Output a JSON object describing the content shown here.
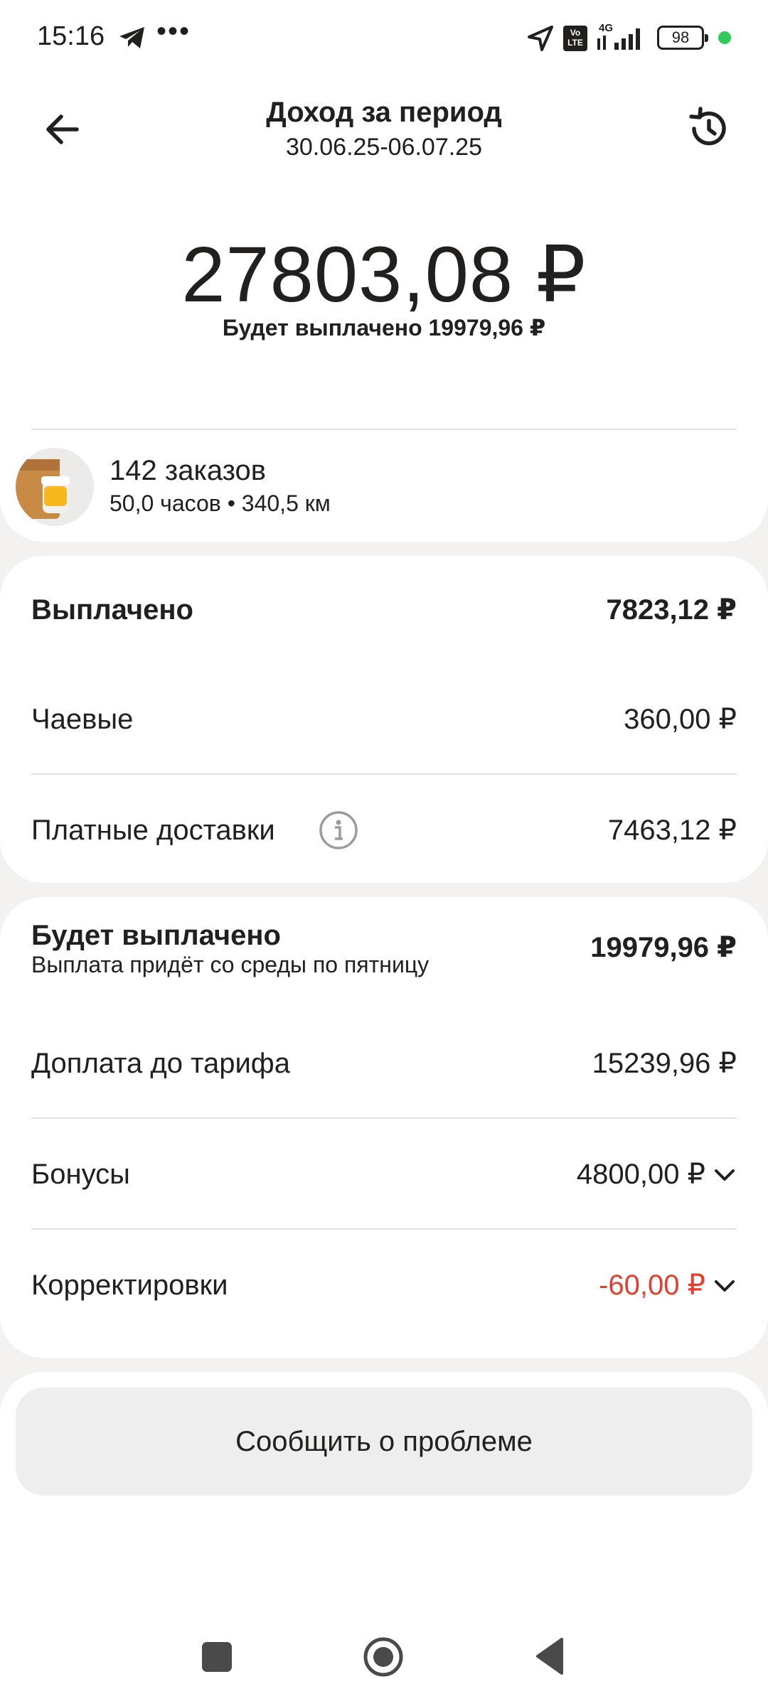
{
  "status_bar": {
    "time": "15:16",
    "dots": "•••",
    "battery": "98",
    "network": "4G",
    "volte": "Vo LTE"
  },
  "header": {
    "title": "Доход за период",
    "period": "30.06.25-06.07.25"
  },
  "summary": {
    "total": "27803,08 ₽",
    "will_be_paid": "Будет выплачено 19979,96 ₽"
  },
  "orders": {
    "count": "142 заказов",
    "meta": "50,0 часов • 340,5 км"
  },
  "paid_section": {
    "title": "Выплачено",
    "total": "7823,12 ₽",
    "rows": [
      {
        "label": "Чаевые",
        "value": "360,00 ₽"
      },
      {
        "label": "Платные доставки",
        "value": "7463,12 ₽"
      }
    ]
  },
  "future_section": {
    "title": "Будет выплачено",
    "subtitle": "Выплата придёт со среды по пятницу",
    "total": "19979,96 ₽",
    "rows": [
      {
        "label": "Доплата до тарифа",
        "value": "15239,96 ₽"
      },
      {
        "label": "Бонусы",
        "value": "4800,00 ₽"
      },
      {
        "label": "Корректировки",
        "value": "-60,00 ₽"
      }
    ]
  },
  "actions": {
    "report_problem": "Сообщить о проблеме"
  },
  "colors": {
    "background": "#f3f2f0",
    "card": "#ffffff",
    "negative": "#e2402f",
    "button": "#eeeeee"
  }
}
